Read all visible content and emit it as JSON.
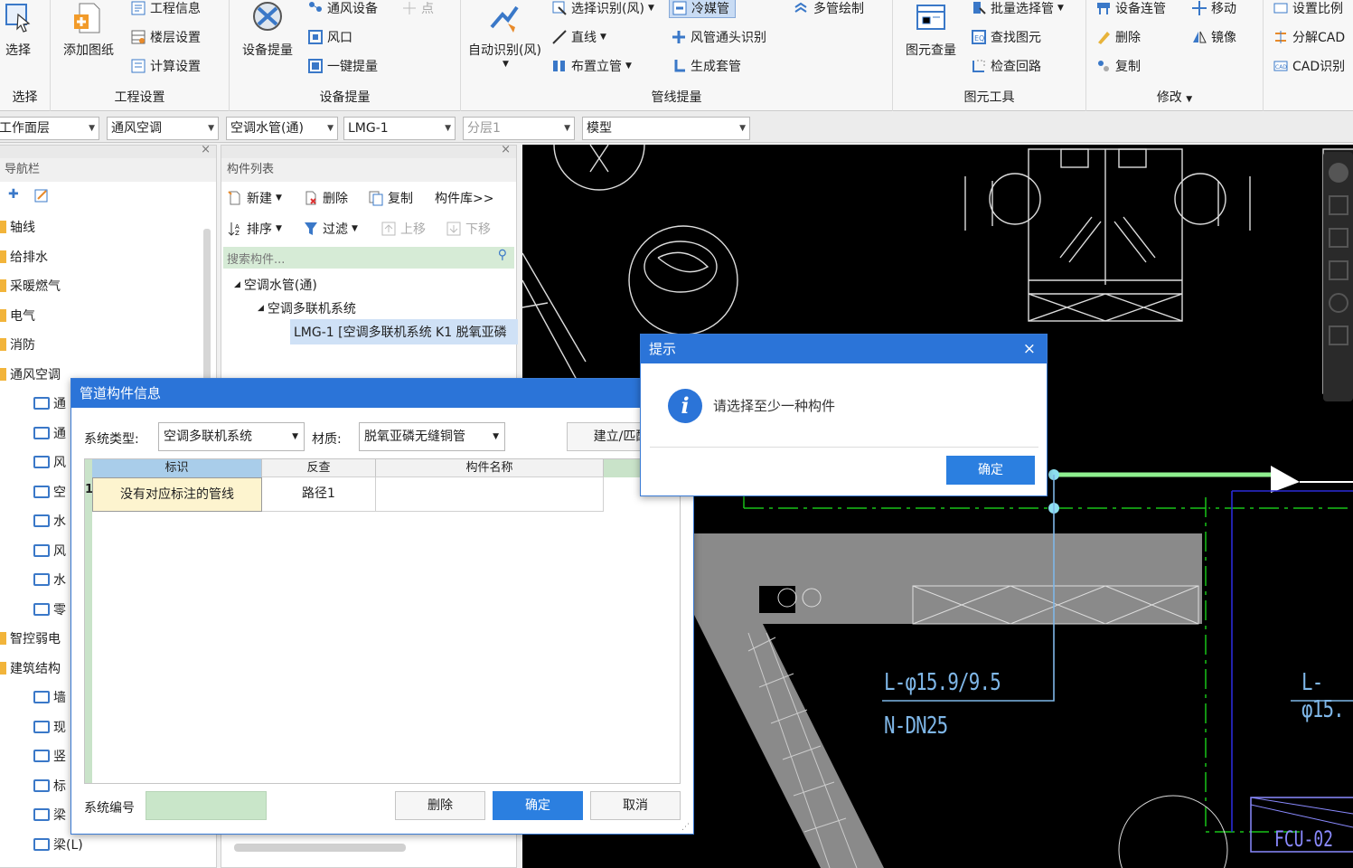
{
  "ribbon": {
    "select": {
      "btn": "选择",
      "group": "选择"
    },
    "project": {
      "add_drawing": "添加图纸",
      "info": "工程信息",
      "floor": "楼层设置",
      "calc": "计算设置",
      "group": "工程设置"
    },
    "equipment": {
      "extract": "设备提量",
      "hvac": "通风设备",
      "point": "点",
      "vent": "风口",
      "oneclick": "一键提量",
      "group": "设备提量"
    },
    "pipeline": {
      "auto": "自动识别(风)",
      "sel_recog": "选择识别(风)",
      "line": "直线",
      "riser": "布置立管",
      "refrig": "冷媒管",
      "duct_head": "风管通头识别",
      "sleeve": "生成套管",
      "multi": "多管绘制",
      "group": "管线提量"
    },
    "tools": {
      "check": "图元查量",
      "batch": "批量选择管",
      "find": "查找图元",
      "loop": "检查回路",
      "group": "图元工具"
    },
    "modify": {
      "connect": "设备连管",
      "move": "移动",
      "delete": "删除",
      "mirror": "镜像",
      "copy": "复制",
      "group": "修改"
    },
    "cad": {
      "scale": "设置比例",
      "split": "分解CAD",
      "recog": "CAD识别"
    }
  },
  "toolbar": {
    "c1": "工作面层",
    "c2": "通风空调",
    "c3": "空调水管(通)",
    "c4": "LMG-1",
    "c5": "分层1",
    "c6": "模型"
  },
  "nav": {
    "title": "导航栏",
    "items": [
      "轴线",
      "给排水",
      "采暖燃气",
      "电气",
      "消防",
      "通风空调"
    ],
    "subitems": [
      "通",
      "通",
      "风",
      "空",
      "水",
      "风",
      "水",
      "零"
    ],
    "items2": [
      "智控弱电",
      "建筑结构"
    ],
    "subitems2": [
      "墙",
      "现",
      "竖",
      "标",
      "梁",
      "梁(L)"
    ]
  },
  "comp": {
    "title": "构件列表",
    "new": "新建",
    "delete": "删除",
    "copy": "复制",
    "lib": "构件库>>",
    "sort": "排序",
    "filter": "过滤",
    "up": "上移",
    "down": "下移",
    "search_ph": "搜索构件...",
    "t1": "空调水管(通)",
    "t2": "空调多联机系统",
    "t3": "LMG-1 [空调多联机系统 K1 脱氧亚磷"
  },
  "pipe_dlg": {
    "title": "管道构件信息",
    "sys_label": "系统类型:",
    "sys_val": "空调多联机系统",
    "mat_label": "材质:",
    "mat_val": "脱氧亚磷无缝铜管",
    "match": "建立/匹配",
    "cols": [
      "标识",
      "反查",
      "构件名称"
    ],
    "row": {
      "num": "1",
      "id": "没有对应标注的管线",
      "check": "路径1",
      "name": ""
    },
    "sysno_label": "系统编号",
    "delete": "删除",
    "ok": "确定",
    "cancel": "取消"
  },
  "tip_dlg": {
    "title": "提示",
    "close": "×",
    "msg": "请选择至少一种构件",
    "ok": "确定"
  },
  "cad_text": {
    "l1": "L-φ15.9/9.5",
    "l2": "N-DN25",
    "l3": "L-φ15.",
    "fcu": "FCU-02"
  }
}
